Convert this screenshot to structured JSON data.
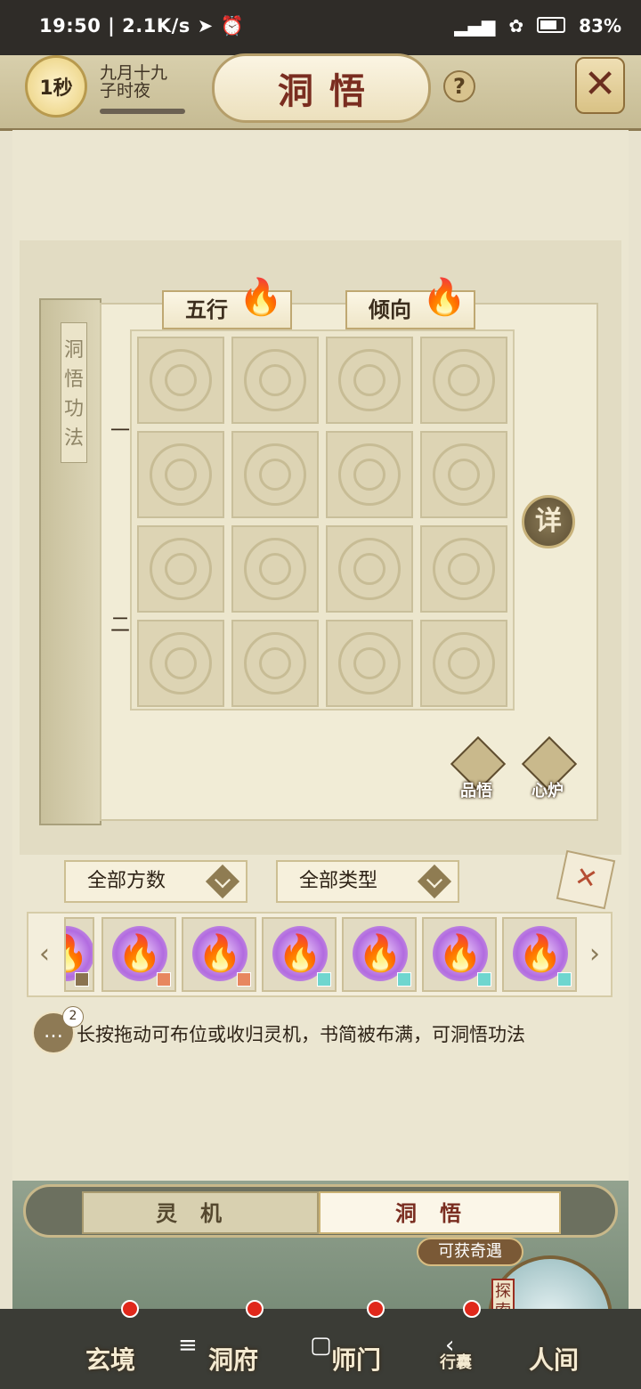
{
  "status_bar": {
    "time": "19:50",
    "speed": "2.1K/s",
    "battery": "83%"
  },
  "header": {
    "timer": "1秒",
    "date_line1": "九月十九",
    "date_line2": "子时夜",
    "title": "洞悟",
    "help": "?",
    "close": "✕"
  },
  "book": {
    "cover_title": "洞悟功法",
    "tabs": [
      "五行",
      "倾向"
    ],
    "row_marks": [
      "一",
      "二"
    ],
    "detail_button": "详",
    "actions": [
      "品悟",
      "心炉"
    ]
  },
  "filters": {
    "count_filter": "全部方数",
    "type_filter": "全部类型"
  },
  "items": [
    {
      "tag_color": "#8a7350"
    },
    {
      "tag_color": "#e7875f"
    },
    {
      "tag_color": "#e7875f"
    },
    {
      "tag_color": "#6fd6cf"
    },
    {
      "tag_color": "#6fd6cf"
    },
    {
      "tag_color": "#6fd6cf"
    },
    {
      "tag_color": "#6fd6cf"
    }
  ],
  "hint": {
    "badge": "2",
    "text": "长按拖动可布位或收归灵机，书简被布满，可洞悟功法"
  },
  "switch_tabs": {
    "left": "灵机",
    "right": "洞悟"
  },
  "encounter_label": "可获奇遇",
  "explore_tag": "探索中",
  "bottom_nav": [
    "玄境",
    "洞府",
    "师门",
    "行囊",
    "人间"
  ]
}
